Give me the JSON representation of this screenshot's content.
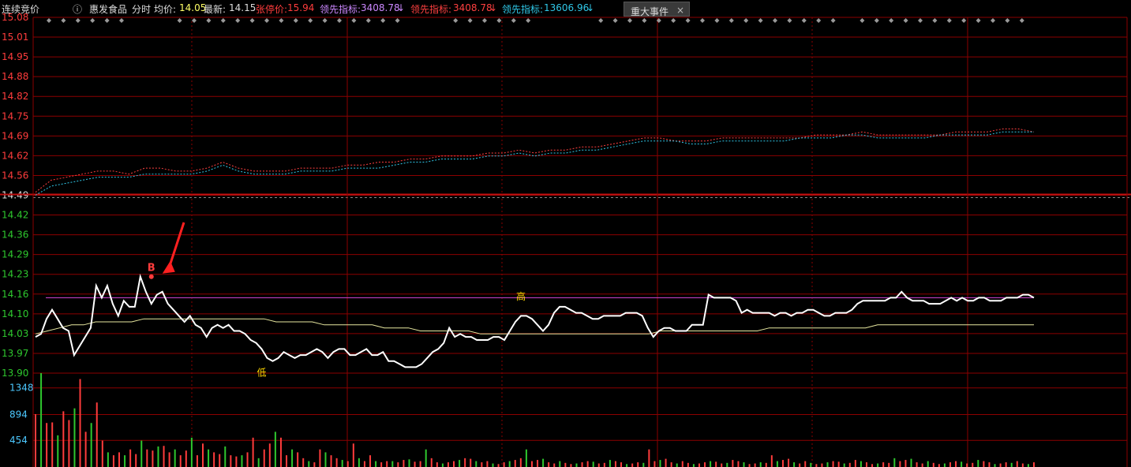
{
  "header": {
    "auction_label": "连续竞价",
    "info_icon": "info-icon",
    "stock_name": "惠发食品",
    "period_label": "分时",
    "avg_label": "均价:",
    "avg_value": "14.05",
    "latest_label": "最新:",
    "latest_value": "14.15",
    "limit_up_label": "张停价:",
    "limit_up_value": "15.94",
    "lead1_label": "领先指标:",
    "lead1_value": "3408.78",
    "lead1_arrow": "↓",
    "lead2_label": "领先指标:",
    "lead2_value": "3408.78",
    "lead2_arrow": "↓",
    "lead3_label": "领先指标:",
    "lead3_value": "13606.96",
    "lead3_arrow": "↓",
    "event_button": "重大事件",
    "close_glyph": "×"
  },
  "colors": {
    "up": "#ff3c3c",
    "down": "#2ec82e",
    "grid": "#8c0000",
    "price_line": "#ffffff",
    "avg_line": "#e8e8a0",
    "ref_line": "#cc44cc",
    "lead_red": "#ff4040",
    "lead_cyan": "#30c8e8",
    "lead_purple": "#cc88ff"
  },
  "chart_data": {
    "type": "line",
    "price_axis_ticks": [
      "15.08",
      "15.01",
      "14.95",
      "14.88",
      "14.82",
      "14.75",
      "14.69",
      "14.62",
      "14.56",
      "14.49",
      "14.42",
      "14.36",
      "14.29",
      "14.23",
      "14.16",
      "14.10",
      "14.03",
      "13.97",
      "13.90"
    ],
    "price_ylim": [
      13.9,
      15.08
    ],
    "prev_close": 14.49,
    "volume_axis_ticks": [
      "1348",
      "894",
      "454"
    ],
    "volume_ylim": [
      0,
      1600
    ],
    "reference_price": 14.15,
    "annotations": [
      {
        "text": "B",
        "price": 14.22,
        "index": 21
      },
      {
        "text": "高",
        "price": 14.13,
        "index": 88
      },
      {
        "text": "低",
        "price": 13.93,
        "index": 41
      }
    ],
    "series": [
      {
        "name": "price",
        "values": [
          14.02,
          14.03,
          14.08,
          14.11,
          14.08,
          14.05,
          14.04,
          13.96,
          13.99,
          14.02,
          14.05,
          14.19,
          14.15,
          14.19,
          14.13,
          14.09,
          14.14,
          14.12,
          14.12,
          14.22,
          14.17,
          14.13,
          14.16,
          14.17,
          14.13,
          14.11,
          14.09,
          14.07,
          14.09,
          14.06,
          14.05,
          14.02,
          14.05,
          14.06,
          14.05,
          14.06,
          14.04,
          14.04,
          14.03,
          14.01,
          14.0,
          13.98,
          13.95,
          13.94,
          13.95,
          13.97,
          13.96,
          13.95,
          13.96,
          13.96,
          13.97,
          13.98,
          13.97,
          13.95,
          13.97,
          13.98,
          13.98,
          13.96,
          13.96,
          13.97,
          13.98,
          13.96,
          13.96,
          13.97,
          13.94,
          13.94,
          13.93,
          13.92,
          13.92,
          13.92,
          13.93,
          13.95,
          13.97,
          13.98,
          14.0,
          14.05,
          14.02,
          14.03,
          14.02,
          14.02,
          14.01,
          14.01,
          14.01,
          14.02,
          14.02,
          14.01,
          14.04,
          14.07,
          14.09,
          14.09,
          14.08,
          14.06,
          14.04,
          14.06,
          14.1,
          14.12,
          14.12,
          14.11,
          14.1,
          14.1,
          14.09,
          14.08,
          14.08,
          14.09,
          14.09,
          14.09,
          14.09,
          14.1,
          14.1,
          14.1,
          14.09,
          14.05,
          14.02,
          14.04,
          14.05,
          14.05,
          14.04,
          14.04,
          14.04,
          14.06,
          14.06,
          14.06,
          14.16,
          14.15,
          14.15,
          14.15,
          14.15,
          14.14,
          14.1,
          14.11,
          14.1,
          14.1,
          14.1,
          14.1,
          14.09,
          14.1,
          14.1,
          14.09,
          14.1,
          14.1,
          14.11,
          14.11,
          14.1,
          14.09,
          14.09,
          14.1,
          14.1,
          14.1,
          14.11,
          14.13,
          14.14,
          14.14,
          14.14,
          14.14,
          14.14,
          14.15,
          14.15,
          14.17,
          14.15,
          14.14,
          14.14,
          14.14,
          14.13,
          14.13,
          14.13,
          14.14,
          14.15,
          14.14,
          14.15,
          14.14,
          14.14,
          14.15,
          14.15,
          14.14,
          14.14,
          14.14,
          14.15,
          14.15,
          14.15,
          14.16,
          14.16,
          14.15
        ]
      },
      {
        "name": "avg",
        "values": [
          14.03,
          14.04,
          14.05,
          14.06,
          14.06,
          14.07,
          14.07,
          14.07,
          14.07,
          14.08,
          14.08,
          14.08,
          14.08,
          14.08,
          14.08,
          14.08,
          14.08,
          14.08,
          14.08,
          14.08,
          14.07,
          14.07,
          14.07,
          14.07,
          14.06,
          14.06,
          14.06,
          14.06,
          14.06,
          14.05,
          14.05,
          14.05,
          14.04,
          14.04,
          14.04,
          14.04,
          14.04,
          14.03,
          14.03,
          14.03,
          14.03,
          14.03,
          14.03,
          14.03,
          14.03,
          14.03,
          14.03,
          14.03,
          14.03,
          14.03,
          14.03,
          14.03,
          14.04,
          14.04,
          14.04,
          14.04,
          14.04,
          14.04,
          14.04,
          14.04,
          14.04,
          14.05,
          14.05,
          14.05,
          14.05,
          14.05,
          14.05,
          14.05,
          14.05,
          14.05,
          14.06,
          14.06,
          14.06,
          14.06,
          14.06,
          14.06,
          14.06,
          14.06,
          14.06,
          14.06,
          14.06,
          14.06,
          14.06,
          14.06
        ]
      },
      {
        "name": "lead_red",
        "values": [
          14.5,
          14.54,
          14.55,
          14.56,
          14.57,
          14.57,
          14.56,
          14.58,
          14.58,
          14.57,
          14.57,
          14.58,
          14.6,
          14.58,
          14.57,
          14.57,
          14.57,
          14.58,
          14.58,
          14.58,
          14.59,
          14.59,
          14.6,
          14.6,
          14.61,
          14.61,
          14.62,
          14.62,
          14.62,
          14.63,
          14.63,
          14.64,
          14.63,
          14.64,
          14.64,
          14.65,
          14.65,
          14.66,
          14.67,
          14.68,
          14.68,
          14.67,
          14.67,
          14.67,
          14.68,
          14.68,
          14.68,
          14.68,
          14.68,
          14.68,
          14.69,
          14.69,
          14.69,
          14.7,
          14.69,
          14.69,
          14.69,
          14.69,
          14.69,
          14.7,
          14.7,
          14.7,
          14.71,
          14.71,
          14.7
        ]
      },
      {
        "name": "lead_cyan",
        "values": [
          14.49,
          14.52,
          14.53,
          14.54,
          14.55,
          14.55,
          14.55,
          14.56,
          14.56,
          14.56,
          14.56,
          14.57,
          14.59,
          14.57,
          14.56,
          14.56,
          14.56,
          14.57,
          14.57,
          14.57,
          14.58,
          14.58,
          14.58,
          14.59,
          14.6,
          14.6,
          14.61,
          14.61,
          14.61,
          14.62,
          14.62,
          14.63,
          14.62,
          14.63,
          14.63,
          14.64,
          14.64,
          14.65,
          14.66,
          14.67,
          14.67,
          14.67,
          14.66,
          14.66,
          14.67,
          14.67,
          14.67,
          14.67,
          14.67,
          14.68,
          14.68,
          14.68,
          14.69,
          14.69,
          14.68,
          14.68,
          14.68,
          14.68,
          14.69,
          14.69,
          14.69,
          14.69,
          14.7,
          14.7,
          14.7
        ]
      },
      {
        "name": "volume",
        "values": [
          900,
          1600,
          750,
          760,
          540,
          950,
          800,
          1000,
          1500,
          600,
          750,
          1100,
          450,
          250,
          200,
          250,
          200,
          300,
          220,
          450,
          300,
          280,
          350,
          360,
          250,
          300,
          200,
          280,
          500,
          200,
          400,
          300,
          250,
          220,
          350,
          200,
          180,
          200,
          250,
          500,
          150,
          300,
          400,
          600,
          500,
          200,
          300,
          250,
          150,
          100,
          80,
          300,
          250,
          200,
          150,
          120,
          100,
          400,
          150,
          100,
          200,
          100,
          80,
          100,
          100,
          80,
          120,
          130,
          90,
          100,
          300,
          150,
          80,
          60,
          80,
          100,
          120,
          150,
          140,
          100,
          80,
          100,
          60,
          50,
          80,
          100,
          120,
          150,
          300,
          100,
          120,
          140,
          80,
          60,
          100,
          70,
          50,
          60,
          80,
          100,
          90,
          60,
          70,
          120,
          100,
          80,
          50,
          60,
          80,
          70,
          300,
          100,
          120,
          140,
          80,
          60,
          100,
          70,
          50,
          60,
          80,
          100,
          90,
          60,
          70,
          120,
          100,
          80,
          50,
          60,
          80,
          70,
          200,
          100,
          120,
          140,
          80,
          60,
          100,
          70,
          50,
          60,
          80,
          100,
          90,
          60,
          70,
          120,
          100,
          80,
          50,
          60,
          80,
          70,
          150,
          100,
          120,
          140,
          80,
          60,
          100,
          70,
          50,
          60,
          80,
          100,
          90,
          60,
          70,
          120,
          100,
          80,
          50,
          60,
          80,
          70,
          100,
          60,
          50,
          80
        ]
      }
    ]
  }
}
